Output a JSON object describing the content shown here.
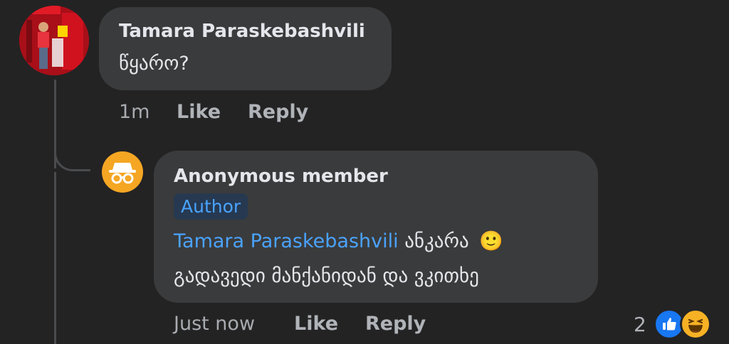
{
  "comment": {
    "author": "Tamara Paraskebashvili",
    "text": "წყარო?",
    "time": "1m",
    "like_label": "Like",
    "reply_label": "Reply"
  },
  "reply": {
    "author": "Anonymous member",
    "badge": "Author",
    "mention": "Tamara Paraskebashvili",
    "text_line1_after_mention": "ანკარა",
    "emoji": "🙂",
    "text_line2": "გადავედი მანქანიდან და ვკითხე",
    "time": "Just now",
    "like_label": "Like",
    "reply_label": "Reply",
    "reaction_count": "2",
    "reactions": [
      "like-icon",
      "haha-icon"
    ]
  },
  "colors": {
    "background": "#232324",
    "bubble": "#3a3b3c",
    "link": "#4aa3ff",
    "anon_avatar": "#f5a623",
    "like_blue": "#1877f2"
  }
}
